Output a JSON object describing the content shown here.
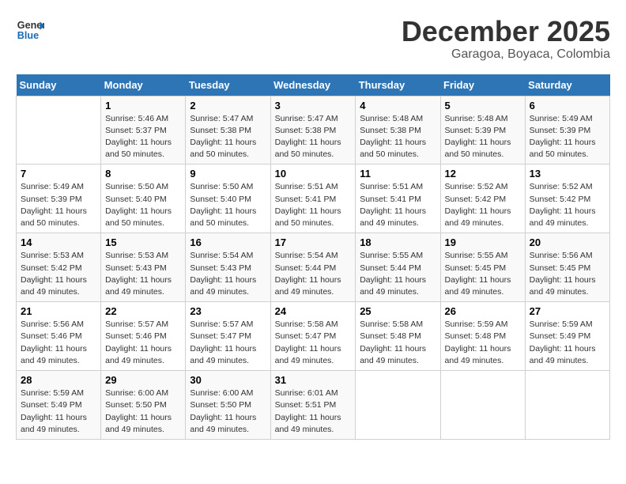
{
  "header": {
    "logo_line1": "General",
    "logo_line2": "Blue",
    "month": "December 2025",
    "location": "Garagoa, Boyaca, Colombia"
  },
  "weekdays": [
    "Sunday",
    "Monday",
    "Tuesday",
    "Wednesday",
    "Thursday",
    "Friday",
    "Saturday"
  ],
  "weeks": [
    [
      {
        "num": "",
        "info": ""
      },
      {
        "num": "1",
        "info": "Sunrise: 5:46 AM\nSunset: 5:37 PM\nDaylight: 11 hours\nand 50 minutes."
      },
      {
        "num": "2",
        "info": "Sunrise: 5:47 AM\nSunset: 5:38 PM\nDaylight: 11 hours\nand 50 minutes."
      },
      {
        "num": "3",
        "info": "Sunrise: 5:47 AM\nSunset: 5:38 PM\nDaylight: 11 hours\nand 50 minutes."
      },
      {
        "num": "4",
        "info": "Sunrise: 5:48 AM\nSunset: 5:38 PM\nDaylight: 11 hours\nand 50 minutes."
      },
      {
        "num": "5",
        "info": "Sunrise: 5:48 AM\nSunset: 5:39 PM\nDaylight: 11 hours\nand 50 minutes."
      },
      {
        "num": "6",
        "info": "Sunrise: 5:49 AM\nSunset: 5:39 PM\nDaylight: 11 hours\nand 50 minutes."
      }
    ],
    [
      {
        "num": "7",
        "info": "Sunrise: 5:49 AM\nSunset: 5:39 PM\nDaylight: 11 hours\nand 50 minutes."
      },
      {
        "num": "8",
        "info": "Sunrise: 5:50 AM\nSunset: 5:40 PM\nDaylight: 11 hours\nand 50 minutes."
      },
      {
        "num": "9",
        "info": "Sunrise: 5:50 AM\nSunset: 5:40 PM\nDaylight: 11 hours\nand 50 minutes."
      },
      {
        "num": "10",
        "info": "Sunrise: 5:51 AM\nSunset: 5:41 PM\nDaylight: 11 hours\nand 50 minutes."
      },
      {
        "num": "11",
        "info": "Sunrise: 5:51 AM\nSunset: 5:41 PM\nDaylight: 11 hours\nand 49 minutes."
      },
      {
        "num": "12",
        "info": "Sunrise: 5:52 AM\nSunset: 5:42 PM\nDaylight: 11 hours\nand 49 minutes."
      },
      {
        "num": "13",
        "info": "Sunrise: 5:52 AM\nSunset: 5:42 PM\nDaylight: 11 hours\nand 49 minutes."
      }
    ],
    [
      {
        "num": "14",
        "info": "Sunrise: 5:53 AM\nSunset: 5:42 PM\nDaylight: 11 hours\nand 49 minutes."
      },
      {
        "num": "15",
        "info": "Sunrise: 5:53 AM\nSunset: 5:43 PM\nDaylight: 11 hours\nand 49 minutes."
      },
      {
        "num": "16",
        "info": "Sunrise: 5:54 AM\nSunset: 5:43 PM\nDaylight: 11 hours\nand 49 minutes."
      },
      {
        "num": "17",
        "info": "Sunrise: 5:54 AM\nSunset: 5:44 PM\nDaylight: 11 hours\nand 49 minutes."
      },
      {
        "num": "18",
        "info": "Sunrise: 5:55 AM\nSunset: 5:44 PM\nDaylight: 11 hours\nand 49 minutes."
      },
      {
        "num": "19",
        "info": "Sunrise: 5:55 AM\nSunset: 5:45 PM\nDaylight: 11 hours\nand 49 minutes."
      },
      {
        "num": "20",
        "info": "Sunrise: 5:56 AM\nSunset: 5:45 PM\nDaylight: 11 hours\nand 49 minutes."
      }
    ],
    [
      {
        "num": "21",
        "info": "Sunrise: 5:56 AM\nSunset: 5:46 PM\nDaylight: 11 hours\nand 49 minutes."
      },
      {
        "num": "22",
        "info": "Sunrise: 5:57 AM\nSunset: 5:46 PM\nDaylight: 11 hours\nand 49 minutes."
      },
      {
        "num": "23",
        "info": "Sunrise: 5:57 AM\nSunset: 5:47 PM\nDaylight: 11 hours\nand 49 minutes."
      },
      {
        "num": "24",
        "info": "Sunrise: 5:58 AM\nSunset: 5:47 PM\nDaylight: 11 hours\nand 49 minutes."
      },
      {
        "num": "25",
        "info": "Sunrise: 5:58 AM\nSunset: 5:48 PM\nDaylight: 11 hours\nand 49 minutes."
      },
      {
        "num": "26",
        "info": "Sunrise: 5:59 AM\nSunset: 5:48 PM\nDaylight: 11 hours\nand 49 minutes."
      },
      {
        "num": "27",
        "info": "Sunrise: 5:59 AM\nSunset: 5:49 PM\nDaylight: 11 hours\nand 49 minutes."
      }
    ],
    [
      {
        "num": "28",
        "info": "Sunrise: 5:59 AM\nSunset: 5:49 PM\nDaylight: 11 hours\nand 49 minutes."
      },
      {
        "num": "29",
        "info": "Sunrise: 6:00 AM\nSunset: 5:50 PM\nDaylight: 11 hours\nand 49 minutes."
      },
      {
        "num": "30",
        "info": "Sunrise: 6:00 AM\nSunset: 5:50 PM\nDaylight: 11 hours\nand 49 minutes."
      },
      {
        "num": "31",
        "info": "Sunrise: 6:01 AM\nSunset: 5:51 PM\nDaylight: 11 hours\nand 49 minutes."
      },
      {
        "num": "",
        "info": ""
      },
      {
        "num": "",
        "info": ""
      },
      {
        "num": "",
        "info": ""
      }
    ]
  ]
}
